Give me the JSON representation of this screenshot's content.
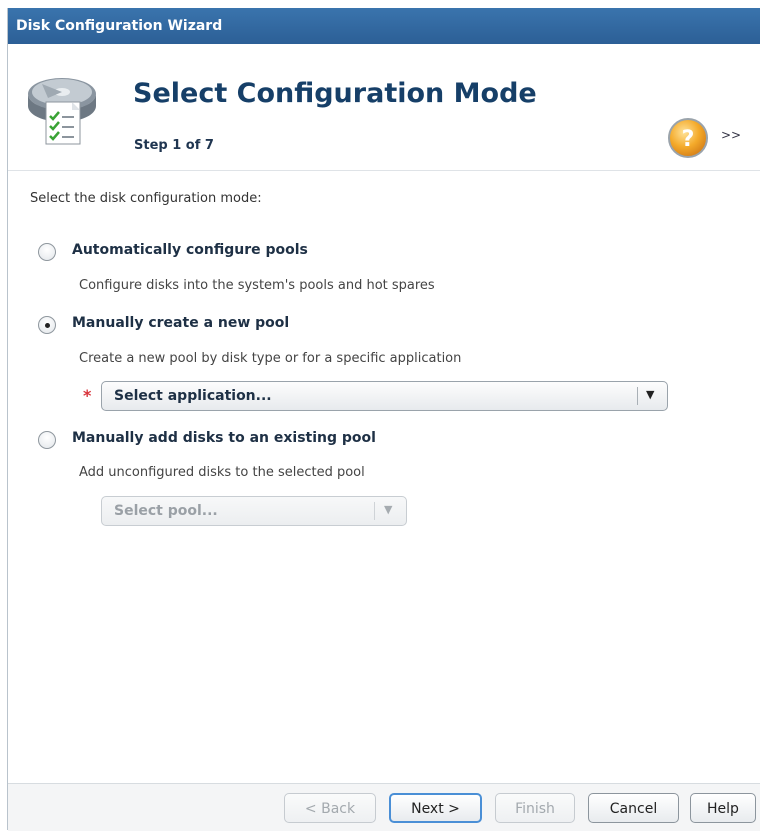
{
  "window": {
    "title": "Disk Configuration Wizard"
  },
  "header": {
    "title": "Select Configuration Mode",
    "step": "Step 1 of 7",
    "expand_label": ">>",
    "help_icon_glyph": "?",
    "icons": [
      "disk-checklist-icon",
      "help-icon",
      "expand-icon"
    ]
  },
  "content": {
    "prompt": "Select the disk configuration mode:",
    "options": [
      {
        "label": "Automatically configure pools",
        "description": "Configure disks into the system's pools and hot spares",
        "selected": false
      },
      {
        "label": "Manually create a new pool",
        "description": "Create a new pool by disk type or for a specific application",
        "selected": true
      },
      {
        "label": "Manually add disks to an existing pool",
        "description": "Add unconfigured disks to the selected pool",
        "selected": false
      }
    ],
    "required_marker": "*",
    "application_select": {
      "value": "Select application...",
      "arrow": "▼",
      "enabled": true
    },
    "pool_select": {
      "value": "Select pool...",
      "arrow": "▼",
      "enabled": false
    }
  },
  "footer": {
    "back_label": "< Back",
    "next_label": "Next >",
    "finish_label": "Finish",
    "cancel_label": "Cancel",
    "help_label": "Help",
    "back_enabled": false,
    "finish_enabled": false
  },
  "colors": {
    "titlebar": "#2c5f96",
    "header_title": "#163f68",
    "required": "#d8333b",
    "help_orange": "#f0a020",
    "primary_border": "#4a8fd6"
  }
}
